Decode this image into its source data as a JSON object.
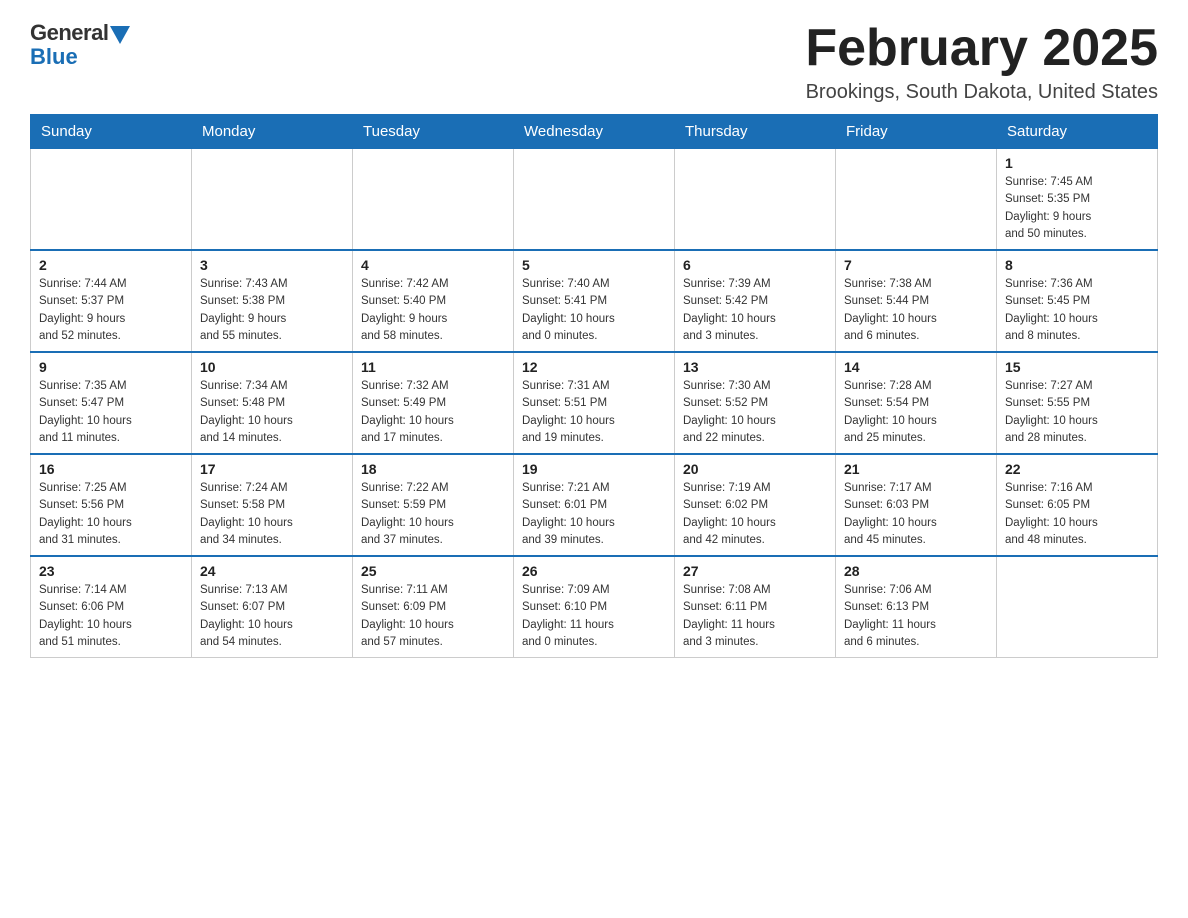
{
  "header": {
    "logo_general": "General",
    "logo_blue": "Blue",
    "month_title": "February 2025",
    "subtitle": "Brookings, South Dakota, United States"
  },
  "days_of_week": [
    "Sunday",
    "Monday",
    "Tuesday",
    "Wednesday",
    "Thursday",
    "Friday",
    "Saturday"
  ],
  "weeks": [
    [
      {
        "day": "",
        "info": ""
      },
      {
        "day": "",
        "info": ""
      },
      {
        "day": "",
        "info": ""
      },
      {
        "day": "",
        "info": ""
      },
      {
        "day": "",
        "info": ""
      },
      {
        "day": "",
        "info": ""
      },
      {
        "day": "1",
        "info": "Sunrise: 7:45 AM\nSunset: 5:35 PM\nDaylight: 9 hours\nand 50 minutes."
      }
    ],
    [
      {
        "day": "2",
        "info": "Sunrise: 7:44 AM\nSunset: 5:37 PM\nDaylight: 9 hours\nand 52 minutes."
      },
      {
        "day": "3",
        "info": "Sunrise: 7:43 AM\nSunset: 5:38 PM\nDaylight: 9 hours\nand 55 minutes."
      },
      {
        "day": "4",
        "info": "Sunrise: 7:42 AM\nSunset: 5:40 PM\nDaylight: 9 hours\nand 58 minutes."
      },
      {
        "day": "5",
        "info": "Sunrise: 7:40 AM\nSunset: 5:41 PM\nDaylight: 10 hours\nand 0 minutes."
      },
      {
        "day": "6",
        "info": "Sunrise: 7:39 AM\nSunset: 5:42 PM\nDaylight: 10 hours\nand 3 minutes."
      },
      {
        "day": "7",
        "info": "Sunrise: 7:38 AM\nSunset: 5:44 PM\nDaylight: 10 hours\nand 6 minutes."
      },
      {
        "day": "8",
        "info": "Sunrise: 7:36 AM\nSunset: 5:45 PM\nDaylight: 10 hours\nand 8 minutes."
      }
    ],
    [
      {
        "day": "9",
        "info": "Sunrise: 7:35 AM\nSunset: 5:47 PM\nDaylight: 10 hours\nand 11 minutes."
      },
      {
        "day": "10",
        "info": "Sunrise: 7:34 AM\nSunset: 5:48 PM\nDaylight: 10 hours\nand 14 minutes."
      },
      {
        "day": "11",
        "info": "Sunrise: 7:32 AM\nSunset: 5:49 PM\nDaylight: 10 hours\nand 17 minutes."
      },
      {
        "day": "12",
        "info": "Sunrise: 7:31 AM\nSunset: 5:51 PM\nDaylight: 10 hours\nand 19 minutes."
      },
      {
        "day": "13",
        "info": "Sunrise: 7:30 AM\nSunset: 5:52 PM\nDaylight: 10 hours\nand 22 minutes."
      },
      {
        "day": "14",
        "info": "Sunrise: 7:28 AM\nSunset: 5:54 PM\nDaylight: 10 hours\nand 25 minutes."
      },
      {
        "day": "15",
        "info": "Sunrise: 7:27 AM\nSunset: 5:55 PM\nDaylight: 10 hours\nand 28 minutes."
      }
    ],
    [
      {
        "day": "16",
        "info": "Sunrise: 7:25 AM\nSunset: 5:56 PM\nDaylight: 10 hours\nand 31 minutes."
      },
      {
        "day": "17",
        "info": "Sunrise: 7:24 AM\nSunset: 5:58 PM\nDaylight: 10 hours\nand 34 minutes."
      },
      {
        "day": "18",
        "info": "Sunrise: 7:22 AM\nSunset: 5:59 PM\nDaylight: 10 hours\nand 37 minutes."
      },
      {
        "day": "19",
        "info": "Sunrise: 7:21 AM\nSunset: 6:01 PM\nDaylight: 10 hours\nand 39 minutes."
      },
      {
        "day": "20",
        "info": "Sunrise: 7:19 AM\nSunset: 6:02 PM\nDaylight: 10 hours\nand 42 minutes."
      },
      {
        "day": "21",
        "info": "Sunrise: 7:17 AM\nSunset: 6:03 PM\nDaylight: 10 hours\nand 45 minutes."
      },
      {
        "day": "22",
        "info": "Sunrise: 7:16 AM\nSunset: 6:05 PM\nDaylight: 10 hours\nand 48 minutes."
      }
    ],
    [
      {
        "day": "23",
        "info": "Sunrise: 7:14 AM\nSunset: 6:06 PM\nDaylight: 10 hours\nand 51 minutes."
      },
      {
        "day": "24",
        "info": "Sunrise: 7:13 AM\nSunset: 6:07 PM\nDaylight: 10 hours\nand 54 minutes."
      },
      {
        "day": "25",
        "info": "Sunrise: 7:11 AM\nSunset: 6:09 PM\nDaylight: 10 hours\nand 57 minutes."
      },
      {
        "day": "26",
        "info": "Sunrise: 7:09 AM\nSunset: 6:10 PM\nDaylight: 11 hours\nand 0 minutes."
      },
      {
        "day": "27",
        "info": "Sunrise: 7:08 AM\nSunset: 6:11 PM\nDaylight: 11 hours\nand 3 minutes."
      },
      {
        "day": "28",
        "info": "Sunrise: 7:06 AM\nSunset: 6:13 PM\nDaylight: 11 hours\nand 6 minutes."
      },
      {
        "day": "",
        "info": ""
      }
    ]
  ]
}
